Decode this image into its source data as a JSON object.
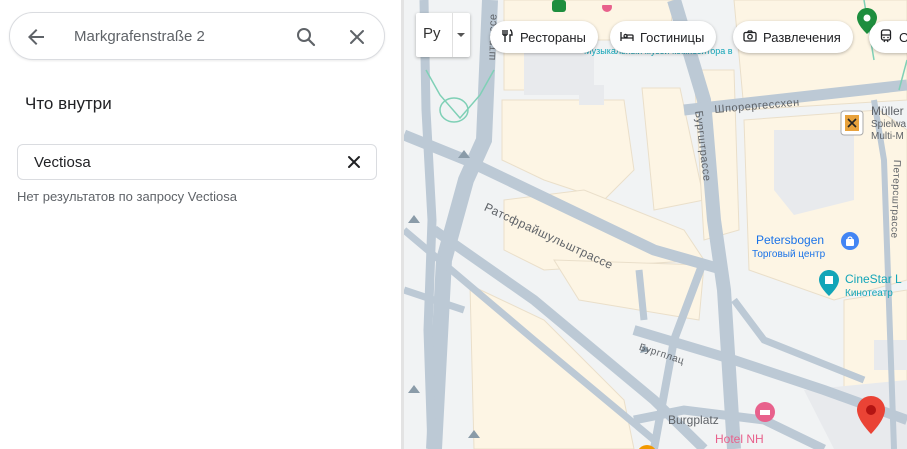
{
  "search": {
    "query": "Markgrafenstraße 2"
  },
  "panel": {
    "title": "Что внутри",
    "filter_value": "Vectiosa",
    "no_results": "Нет результатов по запросу Vectiosa"
  },
  "map": {
    "layer_button": "Ру",
    "chips": [
      {
        "label": "Рестораны",
        "icon": "fork-knife-icon"
      },
      {
        "label": "Гостиницы",
        "icon": "bed-icon"
      },
      {
        "label": "Развлечения",
        "icon": "camera-icon"
      },
      {
        "label": "О",
        "icon": "train-icon"
      }
    ],
    "streets": {
      "ratsfrei": "Ратсфрайшульштрассе",
      "burgstrasse": "Бургштрассе",
      "schporer": "Шпорергессхен",
      "burgplatz": "Бургплац",
      "petersstrasse": "Петерсштрассе",
      "top_street": "штрассе"
    },
    "pois": {
      "museum": "Музыкальный музей композитора в Эпкомпьюте",
      "mueller_name": "Müller",
      "mueller_sub1": "Spielwa",
      "mueller_sub2": "Multi-M",
      "petersbogen_name": "Petersbogen",
      "petersbogen_sub": "Торговый центр",
      "cinestar_name": "CineStar L",
      "cinestar_sub": "Кинотеатр",
      "burgplatz_label": "Burgplatz",
      "hotel_name": "Hotel NH"
    },
    "colors": {
      "road": "#bcc9d5",
      "block": "#fdf5e4",
      "background": "#f1f3f4",
      "pin": "#ea4335",
      "poi_blue": "#4285f4",
      "poi_teal": "#12a5b8",
      "poi_pink": "#e8618c",
      "poi_green": "#1e8e3e"
    }
  }
}
